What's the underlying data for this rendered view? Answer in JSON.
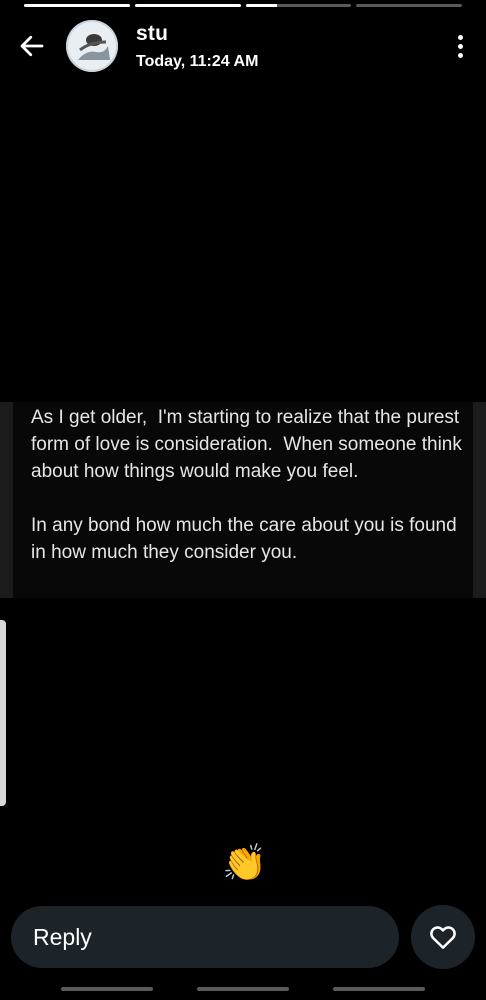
{
  "story": {
    "progress": [
      1.0,
      1.0,
      0.3,
      0.0
    ]
  },
  "header": {
    "user_name": "stu",
    "timestamp": "Today, 11:24 AM",
    "back_icon": "arrow-left-icon",
    "more_icon": "more-vertical-icon"
  },
  "post": {
    "text": "As I get older,  I'm starting to realize that the purest form of love is consideration.  When someone think about how things would make you feel.\n\nIn any bond how much the care about you is found in how much they consider you."
  },
  "reaction": {
    "emoji": "👏",
    "icon": "clapping-hands-icon"
  },
  "reply": {
    "placeholder": "Reply",
    "like_icon": "heart-icon"
  },
  "colors": {
    "background": "#000000",
    "reply_bg": "#1d2429",
    "text": "#ffffff"
  }
}
